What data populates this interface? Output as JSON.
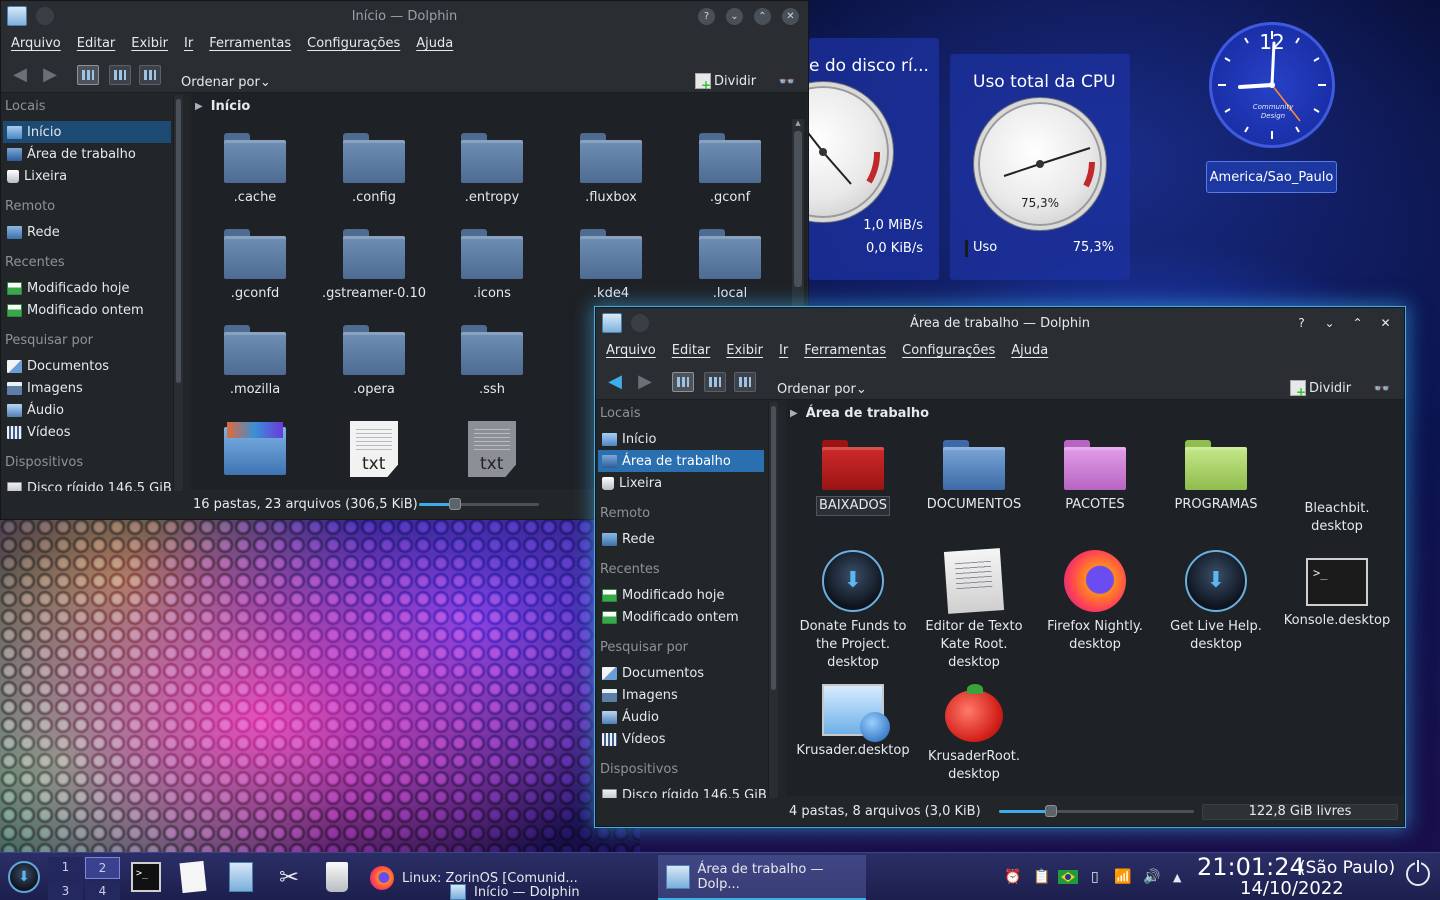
{
  "desktop": {
    "disk_widget": {
      "title": "e do disco rí...",
      "read": "1,0 MiB/s",
      "write": "0,0 KiB/s"
    },
    "cpu_widget": {
      "title": "Uso total da CPU",
      "gauge_value": "75,3%",
      "label": "Uso",
      "value": "75,3%"
    },
    "clock_widget": {
      "timezone": "America/Sao_Paulo",
      "brand": "Community Design"
    }
  },
  "win_inicio": {
    "title": "Início — Dolphin",
    "menu": [
      "Arquivo",
      "Editar",
      "Exibir",
      "Ir",
      "Ferramentas",
      "Configurações",
      "Ajuda"
    ],
    "sort_label": "Ordenar por",
    "split_label": "Dividir",
    "breadcrumb": "Início",
    "sidebar": {
      "sections": {
        "locais": "Locais",
        "remoto": "Remoto",
        "recentes": "Recentes",
        "pesquisar": "Pesquisar por",
        "dispositivos": "Dispositivos"
      },
      "items": {
        "inicio": "Início",
        "area": "Área de trabalho",
        "lixeira": "Lixeira",
        "rede": "Rede",
        "hoje": "Modificado hoje",
        "ontem": "Modificado ontem",
        "documentos": "Documentos",
        "imagens": "Imagens",
        "audio": "Áudio",
        "videos": "Vídeos",
        "disco": "Disco rígido 146,5 GiB"
      }
    },
    "files": {
      "f1": ".cache",
      "f2": ".config",
      "f3": ".entropy",
      "f4": ".fluxbox",
      "f5": ".gconf",
      "f6": ".gconfd",
      "f7": ".gstreamer-0.10",
      "f8": ".icons",
      "f9": ".kde4",
      "f10": ".local",
      "f11": ".mozilla",
      "f12": ".opera",
      "f13": ".ssh",
      "txt": "txt"
    },
    "status": "16 pastas, 23 arquivos (306,5 KiB)",
    "zoom_level": 0.45
  },
  "win_area": {
    "title": "Área de trabalho — Dolphin",
    "menu": [
      "Arquivo",
      "Editar",
      "Exibir",
      "Ir",
      "Ferramentas",
      "Configurações",
      "Ajuda"
    ],
    "sort_label": "Ordenar por",
    "split_label": "Dividir",
    "breadcrumb": "Área de trabalho",
    "sidebar": {
      "sections": {
        "locais": "Locais",
        "remoto": "Remoto",
        "recentes": "Recentes",
        "pesquisar": "Pesquisar por",
        "dispositivos": "Dispositivos"
      },
      "items": {
        "inicio": "Início",
        "area": "Área de trabalho",
        "lixeira": "Lixeira",
        "rede": "Rede",
        "hoje": "Modificado hoje",
        "ontem": "Modificado ontem",
        "documentos": "Documentos",
        "imagens": "Imagens",
        "audio": "Áudio",
        "videos": "Vídeos",
        "disco": "Disco rígido 146,5 GiB"
      }
    },
    "files": {
      "baixados": "BAIXADOS",
      "documentos": "DOCUMENTOS",
      "pacotes": "PACOTES",
      "programas": "PROGRAMAS",
      "bleachbit": "Bleachbit.\ndesktop",
      "donate": "Donate Funds to\nthe Project.\ndesktop",
      "kate": "Editor de Texto\nKate Root.\ndesktop",
      "firefox": "Firefox Nightly.\ndesktop",
      "livehelp": "Get Live Help.\ndesktop",
      "konsole": "Konsole.desktop",
      "krusader": "Krusader.desktop",
      "krusaderroot": "KrusaderRoot.\ndesktop"
    },
    "status": "4 pastas, 8 arquivos (3,0 KiB)",
    "free_space": "122,8 GiB livres",
    "zoom_level": 0.25
  },
  "taskbar": {
    "pager": [
      "1",
      "2",
      "3",
      "4"
    ],
    "tasks": {
      "firefox": "Linux: ZorinOS [Comunid...",
      "dolphin_inicio": "Início — Dolphin",
      "dolphin_area": "Área de trabalho — Dolp..."
    },
    "clock": {
      "time": "21:01:24",
      "tz": "(São Paulo)",
      "date": "14/10/2022"
    }
  },
  "colors": {
    "accent": "#3daee9",
    "window_bg": "#232629",
    "panel": "#1c1f4d"
  }
}
